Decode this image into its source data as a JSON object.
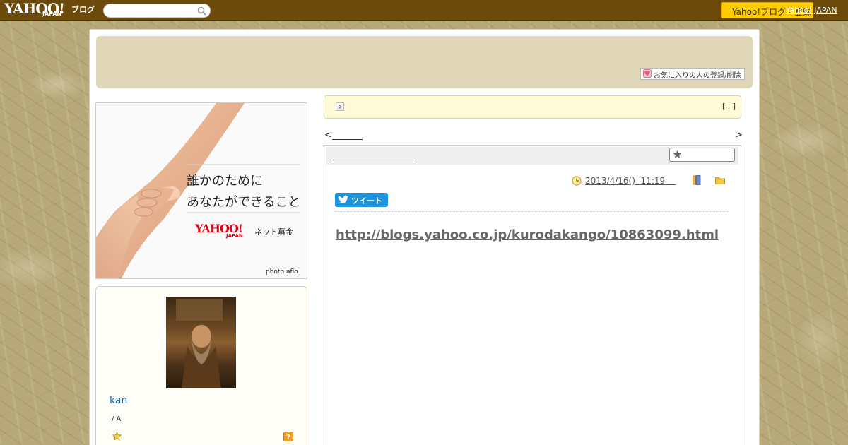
{
  "topbar": {
    "logo": "YAHOO!",
    "logo_sub": "JAPAN",
    "blog_label": "ブログ",
    "search_value": "",
    "yahoo_button": "Yahoo!ブログ - 登録",
    "yahoo_link": "Yahoo! JAPAN"
  },
  "header": {
    "fav_button": "お気に入りの人の登録/削除"
  },
  "banner": {
    "line1": "誰かのために",
    "line2": "あなたができること",
    "brand": "YAHOO!",
    "brand_sub": "JAPAN",
    "brand_text": "ネット募金",
    "credit": "photo:aflo"
  },
  "profile": {
    "username": "kan",
    "info": "/ A"
  },
  "notice": {
    "text": "[ , ]"
  },
  "nav": {
    "prev": "<",
    "next": ">"
  },
  "article": {
    "date": "2013/4/16()  11:19    ",
    "tweet_label": "ツイート",
    "link_text": "http://blogs.yahoo.co.jp/kurodakango/10863099.html"
  },
  "colors": {
    "topbar": "#6b4a0a",
    "header_box": "#e0d7b9",
    "notice_bg": "#fffbd8",
    "tweet": "#1b95e0",
    "yahoo_button": "#ffcc00",
    "username": "#1a6fb8"
  }
}
